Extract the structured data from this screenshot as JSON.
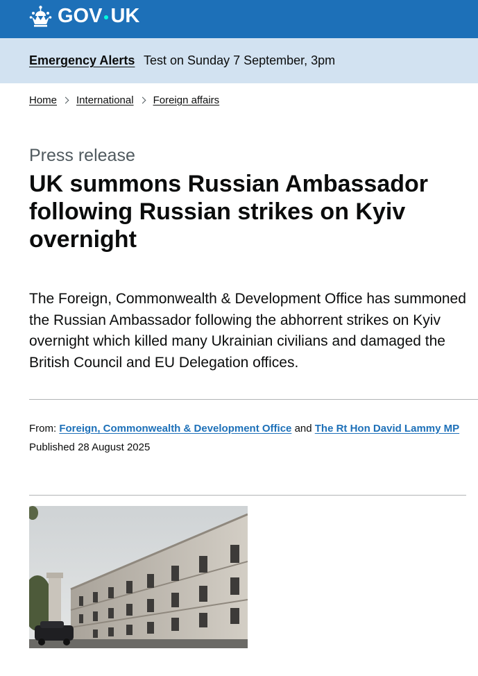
{
  "header": {
    "logo_text_left": "GOV",
    "logo_text_right": "UK",
    "logo_icon": "crown-icon",
    "background_color": "#1d70b8"
  },
  "emergency_banner": {
    "link_label": "Emergency Alerts",
    "text": "Test on Sunday 7 September, 3pm",
    "background_color": "#d2e2f1"
  },
  "breadcrumbs": {
    "items": [
      {
        "label": "Home"
      },
      {
        "label": "International"
      },
      {
        "label": "Foreign affairs"
      }
    ],
    "separator_icon": "chevron-right-icon"
  },
  "article": {
    "caption": "Press release",
    "title": "UK summons Russian Ambassador following Russian strikes on Kyiv overnight",
    "lead": "The Foreign, Commonwealth & Development Office has summoned the Russian Ambassador following the abhorrent strikes on Kyiv overnight which killed many Ukrainian civilians and damaged the British Council and EU Delegation offices.",
    "from_label": "From:",
    "from_org": "Foreign, Commonwealth & Development Office",
    "from_and": "and",
    "from_person": "The Rt Hon David Lammy MP",
    "published_label": "Published",
    "published_date": "28 August 2025",
    "link_color": "#1d70b8"
  },
  "hero_image": {
    "subject": "building-photo"
  }
}
